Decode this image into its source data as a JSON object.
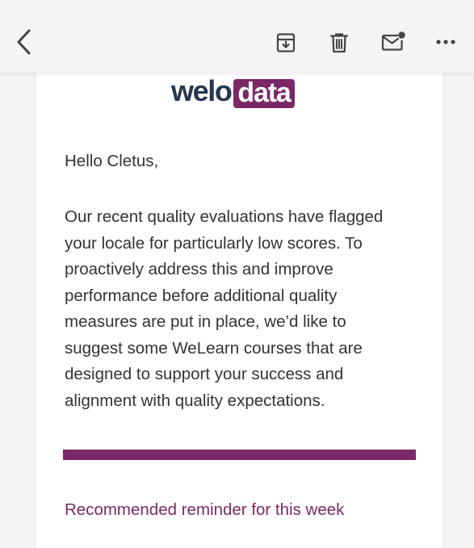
{
  "toolbar": {
    "back_icon": "chevron-left-icon",
    "archive_icon": "archive-download-icon",
    "delete_icon": "trash-icon",
    "mail_icon": "mail-with-dot-icon",
    "more_icon": "ellipsis-icon",
    "icon_color": "#454545"
  },
  "email": {
    "logo": {
      "left_text": "welo",
      "right_text": "data",
      "left_color": "#253850",
      "right_background": "#7b2867",
      "right_text_color": "#ffffff"
    },
    "greeting": "Hello Cletus,",
    "body_lines": [
      "Our recent quality evaluations have flagged",
      "your locale for particularly low scores. To",
      "proactively address this and improve",
      "performance before additional quality",
      "measures are put in place, we’d like to",
      "suggest some WeLearn courses that are",
      "designed to support your success and",
      "alignment with quality expectations."
    ],
    "divider_color": "#7a2a66",
    "reminder_link": "Recommended reminder for this week",
    "reminder_color": "#7a2a66"
  }
}
